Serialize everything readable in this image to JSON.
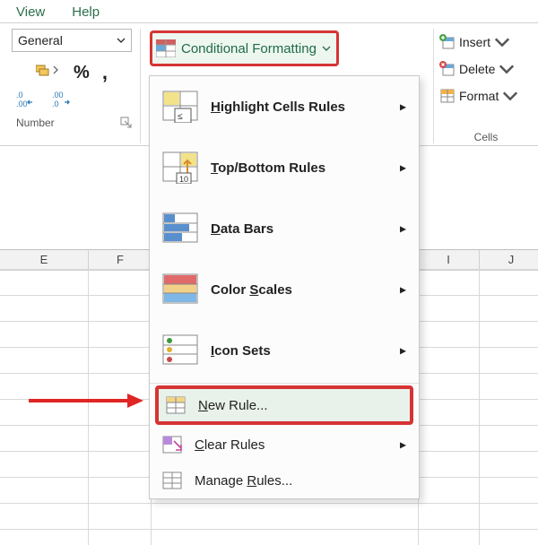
{
  "menubar": {
    "view": "View",
    "help": "Help"
  },
  "number": {
    "format": "General",
    "group_label": "Number"
  },
  "cf": {
    "label": "Conditional Formatting",
    "items": {
      "highlight": "Highlight Cells Rules",
      "topbottom": "Top/Bottom Rules",
      "databars": "Data Bars",
      "colorscales": "Color Scales",
      "iconsets": "Icon Sets",
      "newrule": "New Rule...",
      "clear": "Clear Rules",
      "manage": "Manage Rules..."
    }
  },
  "cells": {
    "insert": "Insert",
    "delete": "Delete",
    "format": "Format",
    "group_label": "Cells"
  },
  "columns": {
    "e": "E",
    "f": "F",
    "i": "I",
    "j": "J"
  }
}
